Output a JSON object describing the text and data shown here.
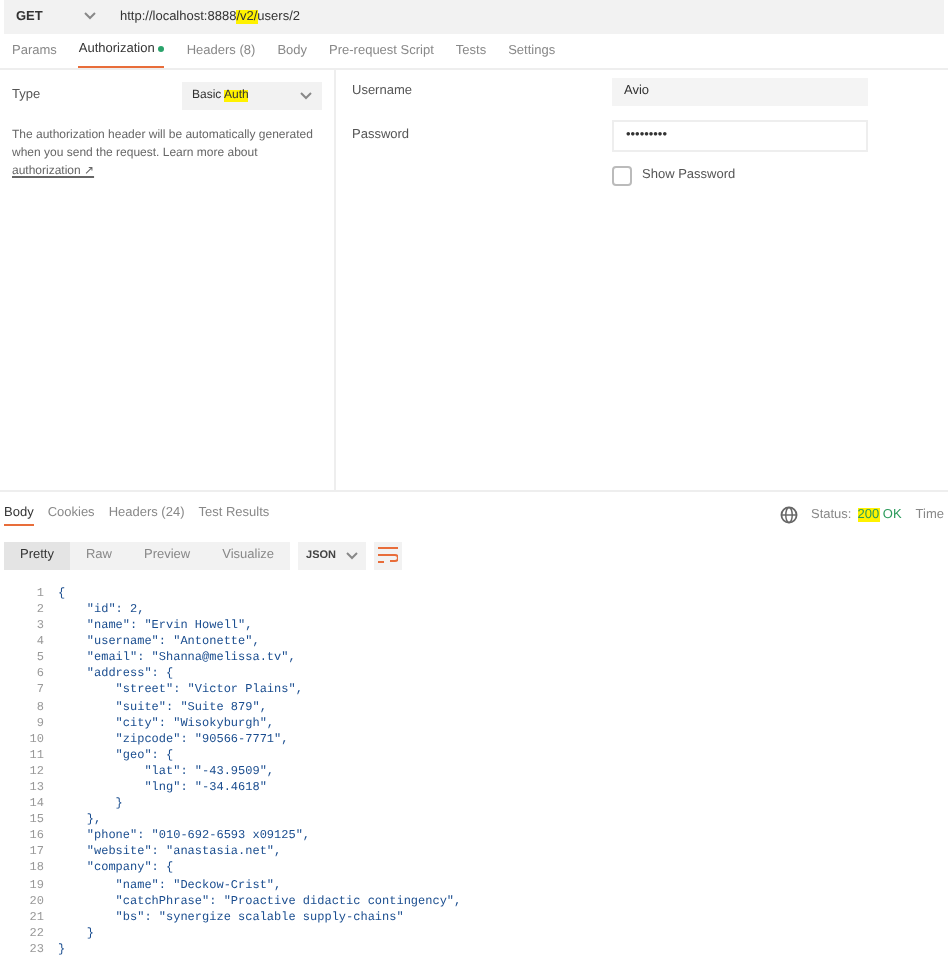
{
  "request": {
    "method": "GET",
    "url": [
      {
        "text": "http://localhost:8888",
        "highlighted": false
      },
      {
        "text": "/v2/",
        "highlighted": true
      },
      {
        "text": "users/2",
        "highlighted": false
      }
    ]
  },
  "request_tabs": [
    {
      "label": "Params",
      "selected": false,
      "dot": false
    },
    {
      "label": "Authorization",
      "selected": true,
      "dot": true
    },
    {
      "label": "Headers (8)",
      "selected": false,
      "dot": false
    },
    {
      "label": "Body",
      "selected": false,
      "dot": false
    },
    {
      "label": "Pre-request Script",
      "selected": false,
      "dot": false
    },
    {
      "label": "Tests",
      "selected": false,
      "dot": false
    },
    {
      "label": "Settings",
      "selected": false,
      "dot": false
    }
  ],
  "auth": {
    "type_label": "Type",
    "type_value": [
      {
        "text": "Basic ",
        "highlighted": false
      },
      {
        "text": "Auth",
        "highlighted": true
      }
    ],
    "description": "The authorization header will be automatically generated when you send the request. Learn more about ",
    "link": "authorization ↗",
    "fields": [
      {
        "label": "Username",
        "value": "Avio"
      },
      {
        "label": "Password",
        "value": "•••••••••"
      }
    ],
    "show_password": {
      "label": "Show Password",
      "checked": false
    }
  },
  "response_tabs": [
    {
      "label": "Body",
      "selected": true
    },
    {
      "label": "Cookies",
      "selected": false
    },
    {
      "label": "Headers (24)",
      "selected": false
    },
    {
      "label": "Test Results",
      "selected": false
    }
  ],
  "status": {
    "label": "Status:",
    "value": [
      {
        "text": "200",
        "highlighted": true
      },
      {
        "text": " OK",
        "highlighted": false
      }
    ],
    "time_label": "Time"
  },
  "view_modes": [
    {
      "label": "Pretty",
      "selected": true
    },
    {
      "label": "Raw",
      "selected": false
    },
    {
      "label": "Preview",
      "selected": false
    },
    {
      "label": "Visualize",
      "selected": false
    }
  ],
  "format": "JSON",
  "code": [
    {
      "n": "1",
      "text": "{"
    },
    {
      "n": "2",
      "text": "    \"id\": 2,"
    },
    {
      "n": "3",
      "text": "    \"name\": \"Ervin Howell\","
    },
    {
      "n": "4",
      "text": "    \"username\": \"Antonette\","
    },
    {
      "n": "5",
      "text": "    \"email\": \"Shanna@melissa.tv\","
    },
    {
      "n": "6",
      "text": "    \"address\": {"
    },
    {
      "n": "7",
      "text": "        \"street\": \"Victor Plains\","
    },
    {
      "n": "8",
      "text": "        \"suite\": \"Suite 879\","
    },
    {
      "n": "9",
      "text": "        \"city\": \"Wisokyburgh\","
    },
    {
      "n": "10",
      "text": "        \"zipcode\": \"90566-7771\","
    },
    {
      "n": "11",
      "text": "        \"geo\": {"
    },
    {
      "n": "12",
      "text": "            \"lat\": \"-43.9509\","
    },
    {
      "n": "13",
      "text": "            \"lng\": \"-34.4618\""
    },
    {
      "n": "14",
      "text": "        }"
    },
    {
      "n": "15",
      "text": "    },"
    },
    {
      "n": "16",
      "text": "    \"phone\": \"010-692-6593 x09125\","
    },
    {
      "n": "17",
      "text": "    \"website\": \"anastasia.net\","
    },
    {
      "n": "18",
      "text": "    \"company\": {"
    },
    {
      "n": "19",
      "text": "        \"name\": \"Deckow-Crist\","
    },
    {
      "n": "20",
      "text": "        \"catchPhrase\": \"Proactive didactic contingency\","
    },
    {
      "n": "21",
      "text": "        \"bs\": \"synergize scalable supply-chains\""
    },
    {
      "n": "22",
      "text": "    }"
    },
    {
      "n": "23",
      "text": "}"
    }
  ]
}
